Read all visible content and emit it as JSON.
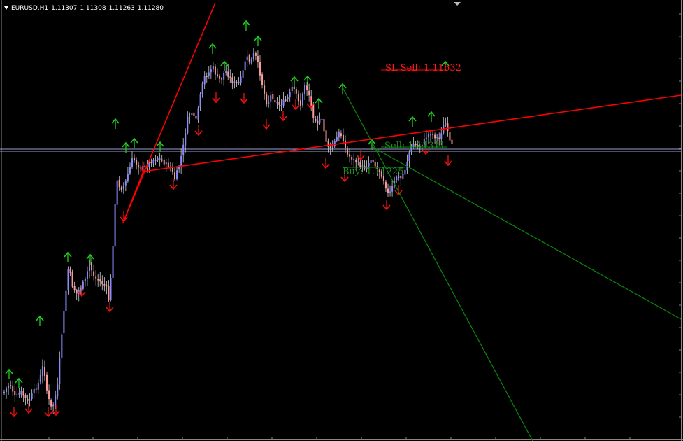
{
  "header": {
    "symbol": "EURUSD,H1",
    "open": "1.11307",
    "high": "1.11308",
    "low": "1.11263",
    "close": "1.11280"
  },
  "orders": {
    "sl_sell_label": "SL Sell: 1.11632",
    "sell_label": "Sell: 1.11311",
    "buy_label": "Buy: 1.11225"
  },
  "colors": {
    "background": "#000000",
    "bull_candle": "#8a8aff",
    "bear_candle": "#ff9a9a",
    "wick": "#d0d0d0",
    "arrow_up": "#22cc22",
    "arrow_down": "#ee1111",
    "trendline_red": "#ff0000",
    "trendline_green": "#0a8a0a",
    "price_line": "#9aa0d0"
  },
  "icons": {
    "up_fractal": "arrow-up-icon",
    "down_fractal": "arrow-down-icon"
  }
}
